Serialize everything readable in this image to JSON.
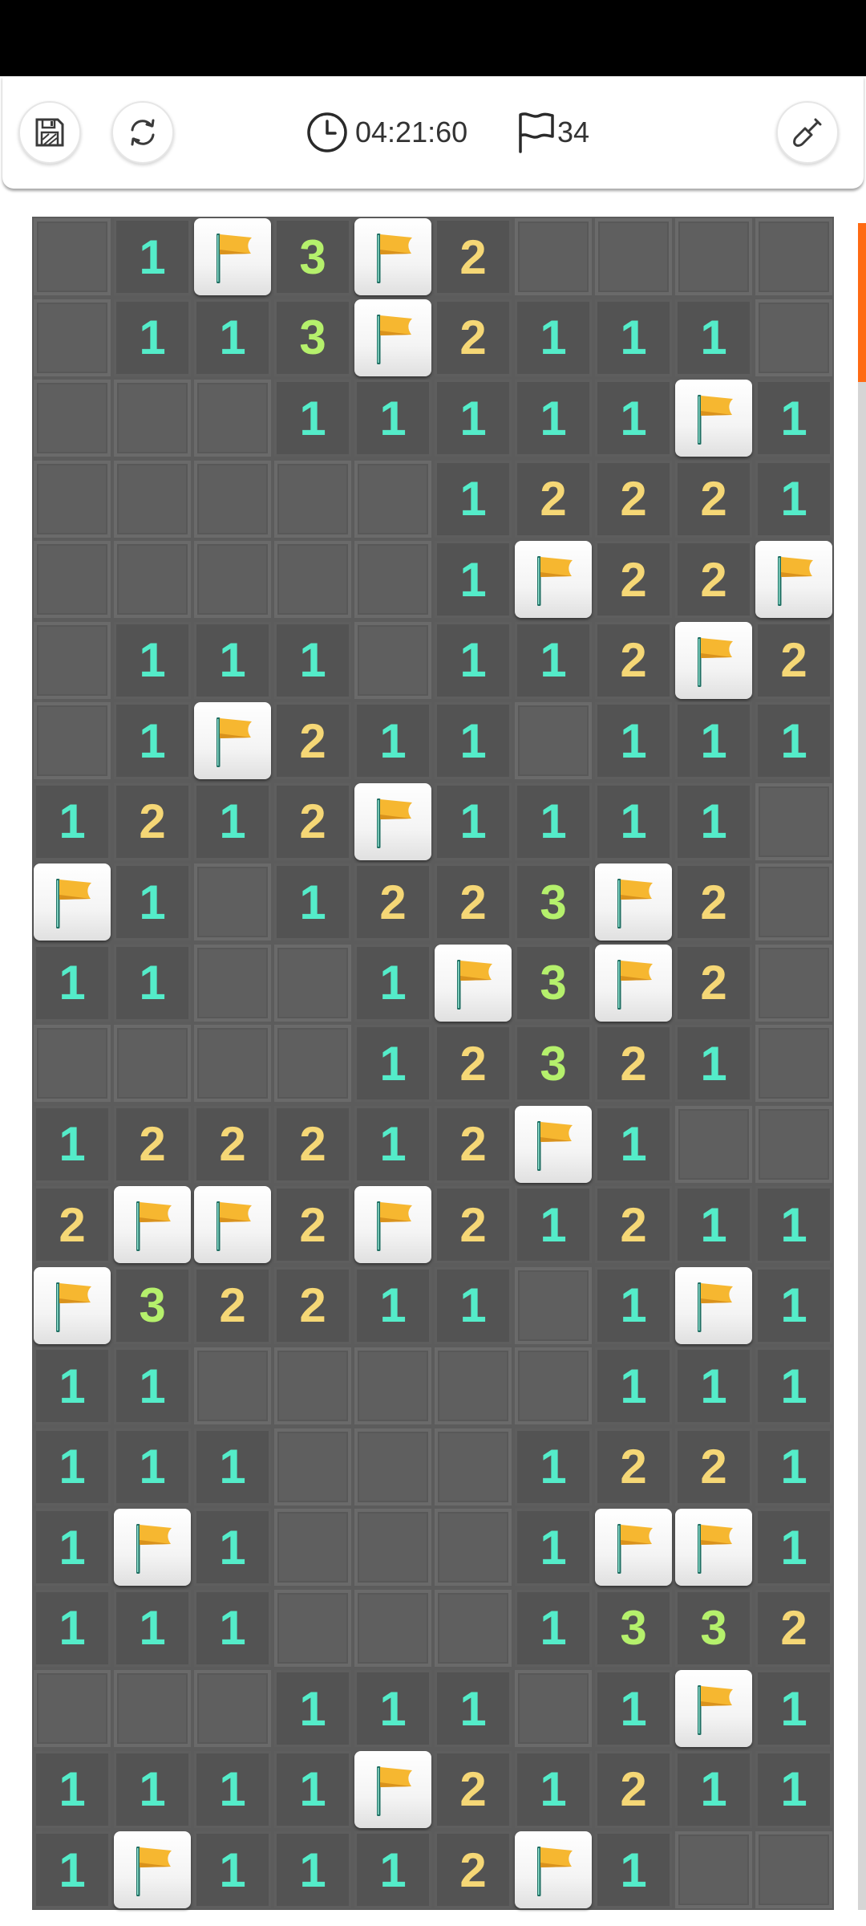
{
  "toolbar": {
    "timer": "04:21:60",
    "flags_count": "34",
    "buttons": {
      "save": "floppy-disk-icon",
      "restart": "restart-icon",
      "tool": "shovel-icon"
    }
  },
  "board": {
    "cols": 10,
    "rows": 21,
    "grid": [
      "_1F3F2____",
      "_113F2111_",
      "___11111F1_",
      "_____12221",
      "_____1F22F",
      "_111_112F2",
      "_1F211_111",
      "1212F1111_",
      "F1_1223F2_",
      "11__1F3F2_",
      "____12321_",
      "122212F1__",
      "2FF2F21211",
      "F32211_1F1",
      "11_____111",
      "111___1221",
      "1F1___1FF1",
      "111___1332",
      "___111_1F1",
      "1111F21211",
      "1F1112F1__"
    ],
    "colors": {
      "one": "#54ecc9",
      "two": "#f5d776",
      "three": "#b5f06c",
      "flag": "#f6b730",
      "accent": "#ff6a13",
      "hidden": "#5f5f5f",
      "open": "#535353"
    }
  },
  "scrollbar": {
    "position": 0.09
  }
}
